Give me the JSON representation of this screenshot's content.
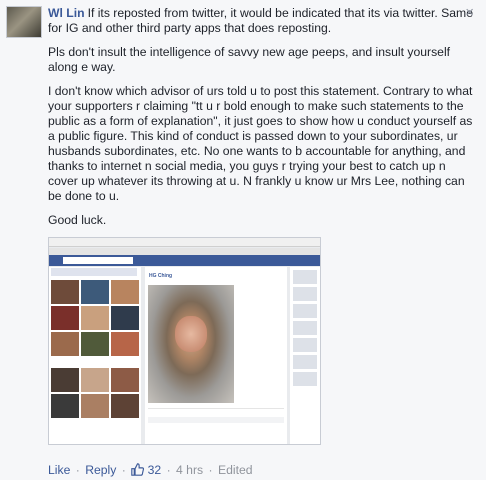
{
  "comment": {
    "author": "Wl Lin",
    "paragraphs": [
      "If its reposted from twitter, it would be indicated that its via twitter. Same for IG and other third party apps that does reposting.",
      "Pls don't insult the intelligence of savvy new age peeps, and insult yourself along e way.",
      "I don't know which advisor of urs told u to post this statement. Contrary to what your supporters r claiming \"tt u r bold enough to make such statements to the public as a form of explanation\", it just goes to show how u conduct yourself as a public figure. This kind of conduct is passed down to your subordinates, ur husbands subordinates, etc. No one wants to b accountable for anything, and thanks to internet n social media, you guys r trying your best to catch up n cover up whatever its throwing at u. N frankly u know ur Mrs Lee, nothing can be done to u.",
      "Good luck."
    ],
    "close_symbol": "×",
    "footer": {
      "like_label": "Like",
      "reply_label": "Reply",
      "like_count": "32",
      "time": "4 hrs",
      "edited_label": "Edited",
      "separator": "·"
    }
  },
  "embedded_screenshot": {
    "post_author": "HG Ching"
  },
  "colors": {
    "link": "#3b5998",
    "meta": "#90949c",
    "background": "#f6f7f9"
  }
}
